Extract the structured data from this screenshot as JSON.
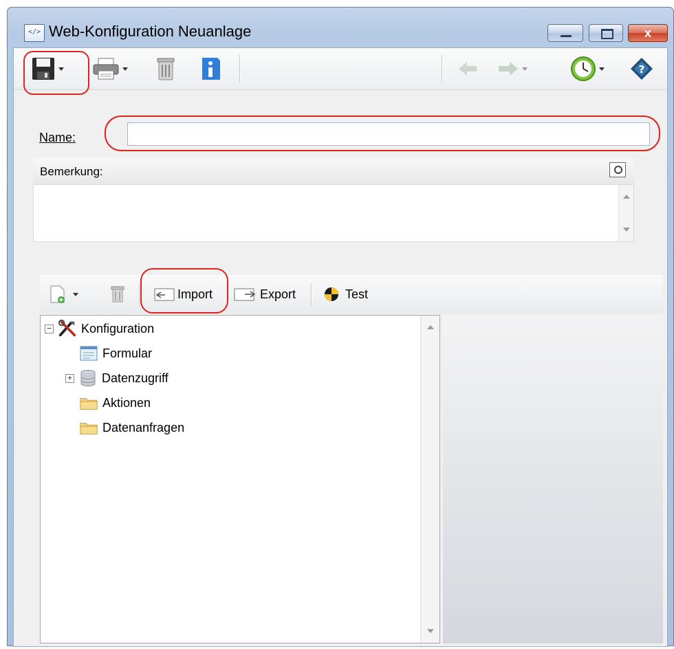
{
  "window": {
    "title": "Web-Konfiguration Neuanlage",
    "icon": "web-config-icon",
    "app_icon_text": "</>",
    "close_glyph": "x"
  },
  "toolbar": {
    "buttons": [
      {
        "icon": "save-icon",
        "dropdown": true
      },
      {
        "icon": "print-icon",
        "dropdown": true
      },
      {
        "icon": "trash-icon",
        "dropdown": false
      },
      {
        "icon": "info-icon",
        "dropdown": false
      },
      {
        "icon": "back-arrow-icon",
        "dropdown": false
      },
      {
        "icon": "forward-arrow-icon",
        "dropdown": true
      },
      {
        "icon": "clock-icon",
        "dropdown": true
      },
      {
        "icon": "help-icon",
        "dropdown": false
      }
    ]
  },
  "form": {
    "name_label": "Name:",
    "name_value": "",
    "bemerkung_label": "Bemerkung:",
    "bemerkung_value": ""
  },
  "tree_toolbar": {
    "import_label": "Import",
    "export_label": "Export",
    "test_label": "Test"
  },
  "tree": {
    "items": [
      {
        "label": "Konfiguration",
        "icon": "tools-icon",
        "expander": "−"
      },
      {
        "label": "Formular",
        "icon": "form-icon"
      },
      {
        "label": "Datenzugriff",
        "icon": "database-icon",
        "expander": "+"
      },
      {
        "label": "Aktionen",
        "icon": "folder-icon"
      },
      {
        "label": "Datenanfragen",
        "icon": "folder-icon"
      }
    ]
  },
  "colors": {
    "highlight": "#e0231d",
    "accent": "#2f7fd8"
  }
}
